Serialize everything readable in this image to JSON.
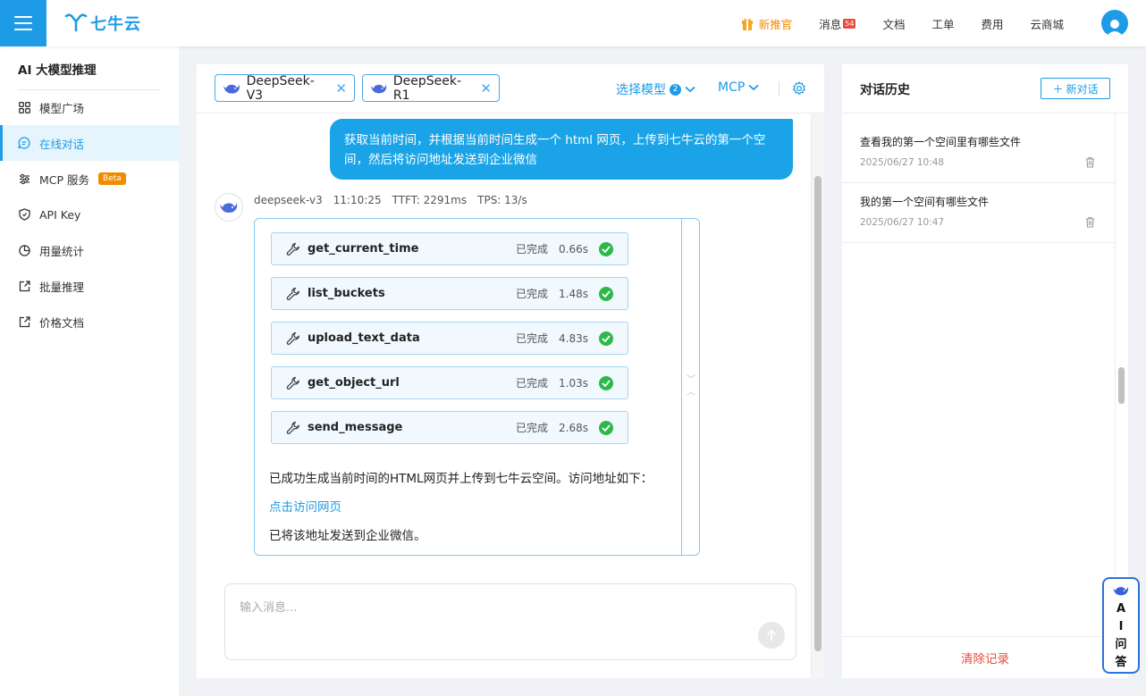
{
  "header": {
    "logo_text": "七牛云",
    "nav": {
      "promo": "新推官",
      "messages": "消息",
      "messages_badge": "54",
      "docs": "文档",
      "tickets": "工单",
      "billing": "费用",
      "market": "云商城"
    }
  },
  "sidebar": {
    "title": "AI 大模型推理",
    "items": [
      {
        "label": "模型广场",
        "icon": "grid-icon"
      },
      {
        "label": "在线对话",
        "icon": "chat-icon",
        "active": true
      },
      {
        "label": "MCP 服务",
        "icon": "sliders-icon",
        "badge": "Beta"
      },
      {
        "label": "API Key",
        "icon": "shield-icon"
      },
      {
        "label": "用量统计",
        "icon": "pie-chart-icon"
      },
      {
        "label": "批量推理",
        "icon": "external-link-icon"
      },
      {
        "label": "价格文档",
        "icon": "external-link-icon"
      }
    ]
  },
  "chat": {
    "models": [
      "DeepSeek-V3",
      "DeepSeek-R1"
    ],
    "select_model": "选择模型",
    "select_model_count": "2",
    "mcp": "MCP",
    "user_message": "获取当前时间，并根据当前时间生成一个 html 网页，上传到七牛云的第一个空间，然后将访问地址发送到企业微信",
    "bot": {
      "model": "deepseek-v3",
      "time": "11:10:25",
      "ttft": "TTFT: 2291ms",
      "tps": "TPS: 13/s"
    },
    "tools": [
      {
        "name": "get_current_time",
        "status": "已完成",
        "time": "0.66s"
      },
      {
        "name": "list_buckets",
        "status": "已完成",
        "time": "1.48s"
      },
      {
        "name": "upload_text_data",
        "status": "已完成",
        "time": "4.83s"
      },
      {
        "name": "get_object_url",
        "status": "已完成",
        "time": "1.03s"
      },
      {
        "name": "send_message",
        "status": "已完成",
        "time": "2.68s"
      }
    ],
    "response_lines": {
      "line1": "已成功生成当前时间的HTML网页并上传到七牛云空间。访问地址如下：",
      "link": "点击访问网页",
      "line3": "已将该地址发送到企业微信。"
    },
    "input_placeholder": "输入消息..."
  },
  "history": {
    "title": "对话历史",
    "new_button": "新对话",
    "items": [
      {
        "title": "查看我的第一个空间里有哪些文件",
        "date": "2025/06/27 10:48"
      },
      {
        "title": "我的第一个空间有哪些文件",
        "date": "2025/06/27 10:47"
      }
    ],
    "clear": "清除记录"
  },
  "ai_widget": {
    "label": "AI问答"
  },
  "colors": {
    "accent": "#1e9be6",
    "user_bubble": "#1aa4e7",
    "success": "#2eb84a",
    "danger": "#e74c3c",
    "promo": "#f08c00"
  }
}
